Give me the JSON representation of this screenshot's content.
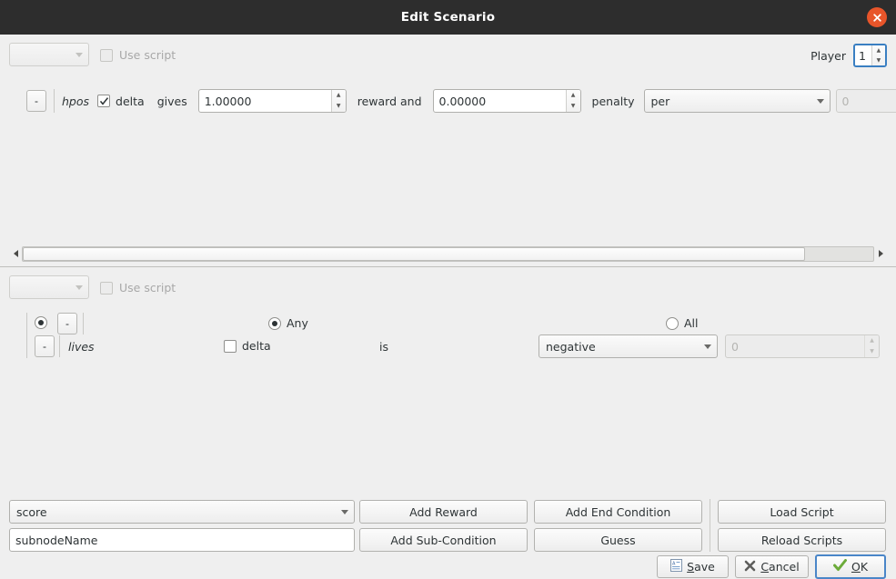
{
  "window": {
    "title": "Edit Scenario",
    "close_icon": "close-circle-icon",
    "titlebar_bg": "#2d2d2d",
    "close_bg": "#e8552a",
    "background": "#efefef",
    "accent": "#4a86c8"
  },
  "reward_section": {
    "script_combo": {
      "value": "",
      "enabled": false
    },
    "use_script_checkbox": {
      "label": "Use script",
      "checked": false,
      "enabled": false
    },
    "player": {
      "label": "Player",
      "value": "1",
      "focused": true
    },
    "rule": {
      "remove_button": "-",
      "variable": "hpos",
      "delta_checkbox": {
        "label": "delta",
        "checked": true
      },
      "gives_label": "gives",
      "reward_value": "1.00000",
      "reward_and_label": "reward and",
      "penalty_value": "0.00000",
      "penalty_label": "penalty",
      "per_combo": {
        "value": "per"
      },
      "per_count": {
        "value": "0",
        "enabled": false
      }
    }
  },
  "scrollbar": {
    "left_arrow_icon": "arrow-left-icon",
    "right_arrow_icon": "arrow-right-icon",
    "thumb_percent": 92
  },
  "condition_section": {
    "script_combo": {
      "value": "",
      "enabled": false
    },
    "use_script_checkbox": {
      "label": "Use script",
      "checked": false,
      "enabled": false
    },
    "rule": {
      "group_radio": {
        "selected": true
      },
      "remove_top_button": "-",
      "remove_bottom_button": "-",
      "variable": "lives",
      "any_radio": {
        "label": "Any",
        "selected": true
      },
      "all_radio": {
        "label": "All",
        "selected": false
      },
      "delta_checkbox": {
        "label": "delta",
        "checked": false
      },
      "is_label": "is",
      "comparison_combo": {
        "value": "negative"
      },
      "threshold": {
        "value": "0",
        "enabled": false
      }
    }
  },
  "bottom_panel": {
    "variable_combo": {
      "value": "score"
    },
    "subnode_input": {
      "value": "subnodeName",
      "placeholder": "subnodeName"
    },
    "buttons": {
      "add_reward": "Add Reward",
      "add_sub_condition": "Add Sub-Condition",
      "add_end_condition": "Add End Condition",
      "guess": "Guess",
      "load_script": "Load Script",
      "reload_scripts": "Reload Scripts"
    }
  },
  "dialog_buttons": {
    "save": {
      "label_pre": "",
      "accel": "S",
      "label_post": "ave",
      "icon": "document-icon"
    },
    "cancel": {
      "label_pre": "",
      "accel": "C",
      "label_post": "ancel",
      "icon": "cross-icon"
    },
    "ok": {
      "label_pre": "",
      "accel": "O",
      "label_post": "K",
      "icon": "checkmark-icon",
      "is_default": true
    }
  }
}
